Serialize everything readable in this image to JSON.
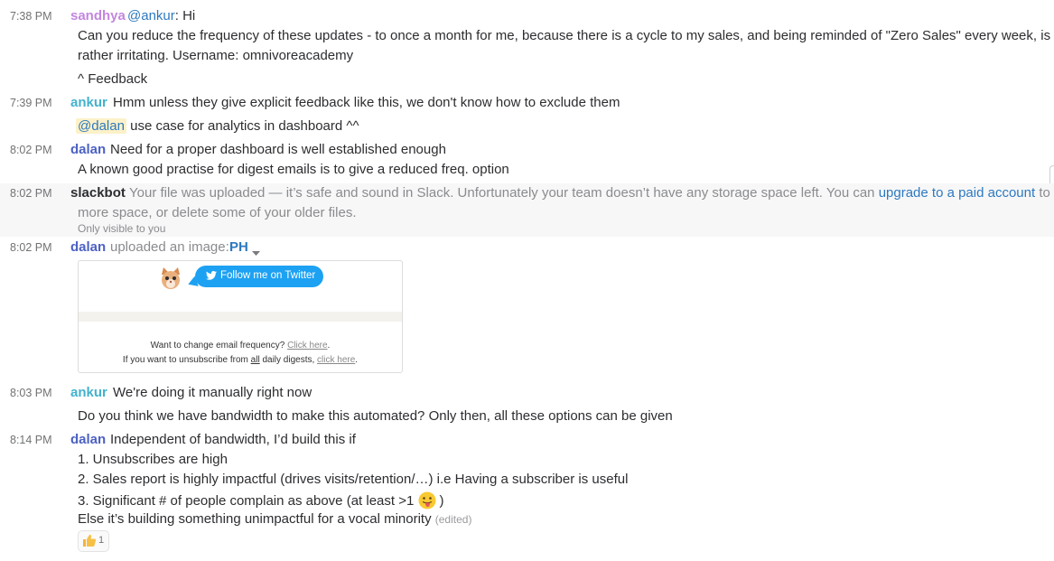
{
  "messages": [
    {
      "time": "7:38 PM",
      "user": "sandhya",
      "mention": "@ankur",
      "after_mention": ": Hi",
      "lines": [
        "Can you reduce the frequency of these updates - to once a month for me, because there is a cycle to my sales, and being reminded of \"Zero Sales\" every week, is",
        "rather irritating. Username: omnivoreacademy",
        "^ Feedback"
      ]
    },
    {
      "time": "7:39 PM",
      "user": "ankur",
      "text": "Hmm unless they give explicit feedback like this, we don't know how to exclude them",
      "line2_mention": "@dalan",
      "line2_text": " use case for analytics in dashboard ^^"
    },
    {
      "time": "8:02 PM",
      "user": "dalan",
      "text": "Need for a proper dashboard is well established enough",
      "line2": "A known good practise for digest emails is to give a reduced freq. option"
    },
    {
      "time": "8:02 PM",
      "user": "slackbot",
      "text_before": "Your file was uploaded — it’s safe and sound in Slack. Unfortunately your team doesn’t have any storage space left. You can ",
      "link": "upgrade to a paid account",
      "text_after": " to get",
      "line2": "more space, or delete some of your older files.",
      "note": "Only visible to you"
    },
    {
      "time": "8:02 PM",
      "user": "dalan",
      "action": "uploaded an image:",
      "file_name": "PH",
      "preview": {
        "button": "Follow me on Twitter",
        "line1_before": "Want to change email frequency? ",
        "line1_link": "Click here",
        "line1_after": ".",
        "line2_before": "If you want to unsubscribe from ",
        "line2_all": "all",
        "line2_mid": " daily digests, ",
        "line2_link": "click here",
        "line2_after": "."
      }
    },
    {
      "time": "8:03 PM",
      "user": "ankur",
      "text": "We're doing it manually right now",
      "line2": "Do you think we have bandwidth to make this automated? Only then, all these options can be given"
    },
    {
      "time": "8:14 PM",
      "user": "dalan",
      "text": "Independent of bandwidth, I’d build this if",
      "items": [
        "1. Unsubscribes are high",
        "2. Sales report is highly impactful (drives visits/retention/…) i.e Having a subscriber is useful",
        "3. Significant # of people complain as above (at least >1 ",
        ")"
      ],
      "last": "Else it’s building something unimpactful for a vocal minority",
      "edited": "(edited)",
      "reaction": {
        "icon": "thumbs-up",
        "count": "1"
      }
    }
  ],
  "colors": {
    "sandhya": "#c386df",
    "ankur": "#43b2ce",
    "dalan": "#4c61c4",
    "link": "#2d79bf",
    "ephemeral_bg": "#f7f7f8"
  }
}
